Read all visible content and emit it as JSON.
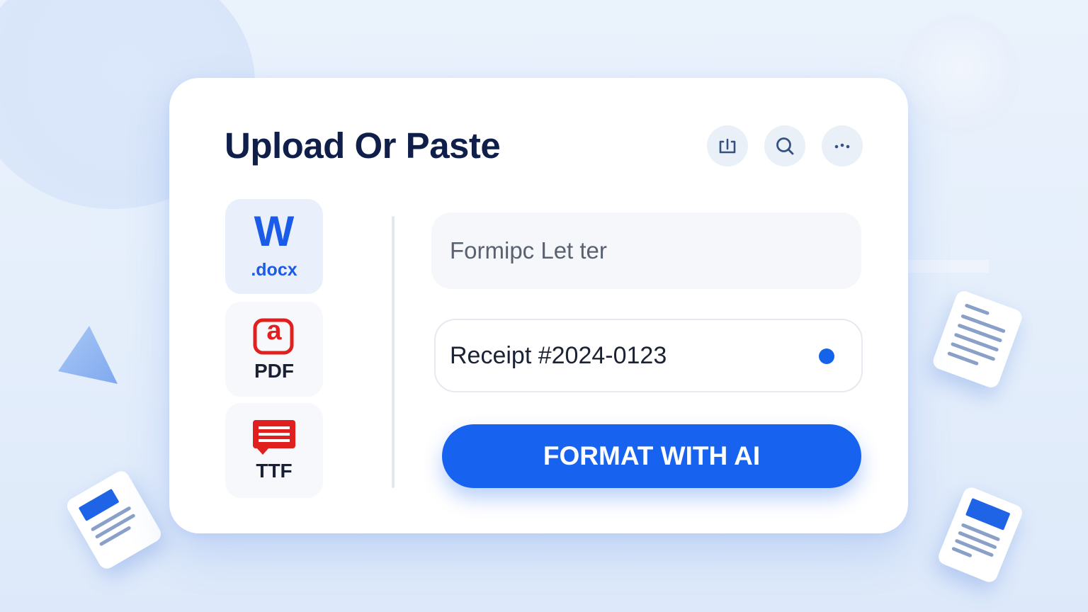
{
  "header": {
    "title": "Upload Or Paste"
  },
  "toolbar": {
    "icons": [
      "frame-icon",
      "search-icon",
      "more-icon"
    ]
  },
  "formats": [
    {
      "glyph": "W",
      "label": ".docx",
      "color": "#1a5ce8",
      "selected": true
    },
    {
      "glyph": "a",
      "label": "PDF",
      "color": "#e0201f",
      "selected": false
    },
    {
      "label": "TTF",
      "color": "#e0201f",
      "selected": false
    }
  ],
  "inputs": {
    "title_value": "Formipc Let ter",
    "receipt_value": "Receipt #2024-0123"
  },
  "actions": {
    "format_label": "FORMAT WITH AI"
  },
  "colors": {
    "accent": "#1763ef",
    "title": "#0f1f4a",
    "pdf_red": "#e0201f"
  }
}
